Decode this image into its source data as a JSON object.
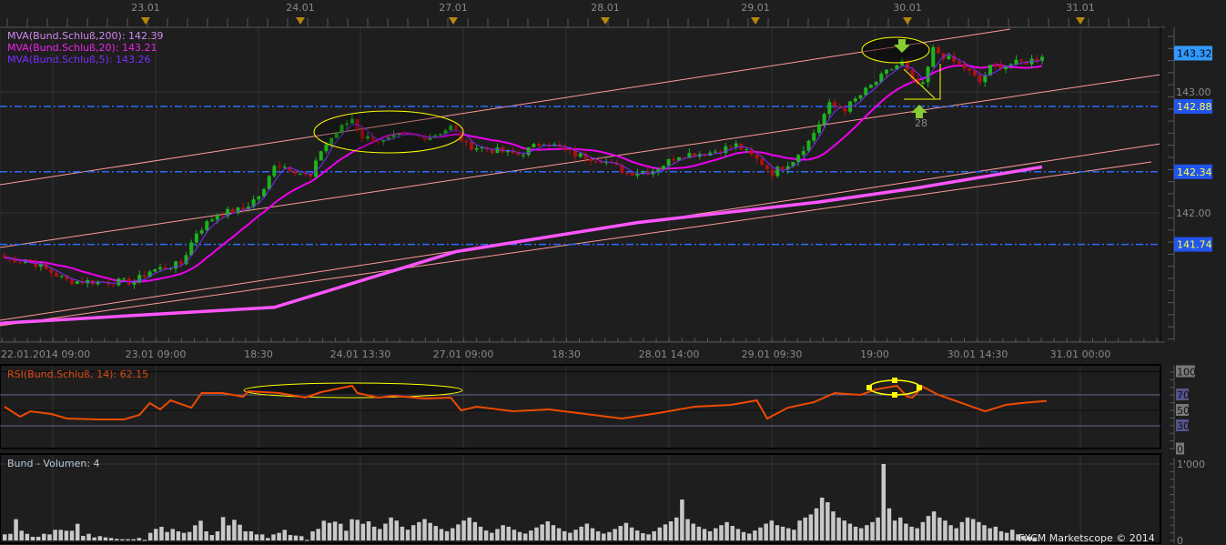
{
  "top_axis": {
    "dates": [
      "23.01",
      "24.01",
      "27.01",
      "28.01",
      "29.01",
      "30.01",
      "31.01"
    ]
  },
  "legend": {
    "ma200": "MVA(Bund.Schluß,200): 142.39",
    "ma20": "MVA(Bund.Schluß,20): 143.21",
    "ma5": "MVA(Bund.Schluß,5): 143.26"
  },
  "price_axis": {
    "ticks": [
      "143.00",
      "142.00"
    ],
    "current": "143.32",
    "levels": [
      "142.88",
      "142.34",
      "141.74"
    ]
  },
  "marker_label": "28",
  "time_axis": [
    "22.01.2014 09:00",
    "23.01 09:00",
    "18:30",
    "24.01 13:30",
    "27.01 09:00",
    "18:30",
    "28.01 14:00",
    "29.01 09:30",
    "19:00",
    "30.01 14:30",
    "31.01 00:00"
  ],
  "rsi": {
    "label": "RSI(Bund.Schluß, 14): 62.15",
    "ticks": [
      "100",
      "70",
      "50",
      "30",
      "0"
    ]
  },
  "volume": {
    "label": "Bund - Volumen: 4",
    "ticks": [
      "1'000",
      "0"
    ]
  },
  "watermark": "FXCM Marketscope © 2014",
  "colors": {
    "bg": "#1e1e1e",
    "up": "#1db31d",
    "down": "#b01010",
    "ma200": "#ff55ff",
    "ma20": "#ee00ee",
    "ma5": "#7a2cff",
    "rsi": "#ee4a00",
    "level": "#2a6bff",
    "channel": "#ff9a9a",
    "annotation": "#ffff00"
  },
  "chart_data": [
    {
      "type": "candlestick",
      "title": "Bund",
      "x_unit": "bar index",
      "close_keypoints": [
        [
          0,
          141.63
        ],
        [
          6,
          141.58
        ],
        [
          12,
          141.44
        ],
        [
          18,
          141.43
        ],
        [
          25,
          141.43
        ],
        [
          28,
          141.52
        ],
        [
          34,
          141.58
        ],
        [
          37,
          141.84
        ],
        [
          41,
          141.99
        ],
        [
          46,
          142.03
        ],
        [
          50,
          142.18
        ],
        [
          52,
          142.41
        ],
        [
          55,
          142.37
        ],
        [
          59,
          142.29
        ],
        [
          61,
          142.52
        ],
        [
          64,
          142.67
        ],
        [
          67,
          142.78
        ],
        [
          69,
          142.63
        ],
        [
          73,
          142.59
        ],
        [
          76,
          142.63
        ],
        [
          82,
          142.63
        ],
        [
          86,
          142.71
        ],
        [
          89,
          142.56
        ],
        [
          94,
          142.52
        ],
        [
          99,
          142.48
        ],
        [
          104,
          142.59
        ],
        [
          110,
          142.48
        ],
        [
          115,
          142.44
        ],
        [
          120,
          142.33
        ],
        [
          125,
          142.35
        ],
        [
          130,
          142.48
        ],
        [
          136,
          142.5
        ],
        [
          141,
          142.56
        ],
        [
          146,
          142.41
        ],
        [
          148,
          142.33
        ],
        [
          152,
          142.44
        ],
        [
          155,
          142.59
        ],
        [
          159,
          142.89
        ],
        [
          162,
          142.86
        ],
        [
          166,
          143.01
        ],
        [
          170,
          143.16
        ],
        [
          173,
          143.25
        ],
        [
          175,
          143.08
        ],
        [
          177,
          143.05
        ],
        [
          179,
          143.35
        ],
        [
          182,
          143.27
        ],
        [
          185,
          143.2
        ],
        [
          188,
          143.08
        ],
        [
          190,
          143.2
        ],
        [
          194,
          143.23
        ],
        [
          197,
          143.25
        ],
        [
          200,
          143.29
        ]
      ],
      "ma200_keypoints": [
        [
          0,
          141.09
        ],
        [
          52,
          141.22
        ],
        [
          87,
          141.68
        ],
        [
          122,
          141.92
        ],
        [
          157,
          142.09
        ],
        [
          175,
          142.2
        ],
        [
          200,
          142.38
        ]
      ],
      "horizontal_levels": [
        142.88,
        142.34,
        141.74
      ],
      "last_price": 143.32,
      "ylim": [
        141.0,
        143.55
      ]
    },
    {
      "type": "line",
      "title": "RSI(Bund.Schluß, 14)",
      "points": [
        [
          0,
          54.7
        ],
        [
          3,
          41.8
        ],
        [
          5,
          48.8
        ],
        [
          9,
          45.3
        ],
        [
          12,
          39.4
        ],
        [
          18,
          38.2
        ],
        [
          23,
          38.2
        ],
        [
          26,
          44.1
        ],
        [
          28,
          59.4
        ],
        [
          30,
          51.2
        ],
        [
          32,
          62.9
        ],
        [
          36,
          53.5
        ],
        [
          38,
          72.4
        ],
        [
          42,
          72.4
        ],
        [
          46,
          67.6
        ],
        [
          47,
          74.7
        ],
        [
          53,
          72.4
        ],
        [
          58,
          66.5
        ],
        [
          61,
          73.5
        ],
        [
          67,
          81.8
        ],
        [
          68,
          72.4
        ],
        [
          72,
          66.5
        ],
        [
          75,
          68.8
        ],
        [
          81,
          65.3
        ],
        [
          86,
          66.5
        ],
        [
          88,
          50
        ],
        [
          91,
          54.7
        ],
        [
          98,
          48.8
        ],
        [
          105,
          51.2
        ],
        [
          112,
          45.3
        ],
        [
          119,
          39.4
        ],
        [
          126,
          46.5
        ],
        [
          133,
          54.7
        ],
        [
          140,
          57.1
        ],
        [
          145,
          62.9
        ],
        [
          147,
          39.4
        ],
        [
          151,
          53.5
        ],
        [
          156,
          60.6
        ],
        [
          160,
          72.4
        ],
        [
          165,
          70
        ],
        [
          168,
          77
        ],
        [
          172,
          81.8
        ],
        [
          174,
          67.6
        ],
        [
          175,
          66.5
        ],
        [
          177,
          80.6
        ],
        [
          180,
          70
        ],
        [
          184,
          60.6
        ],
        [
          189,
          48.8
        ],
        [
          193,
          57.1
        ],
        [
          196,
          59.4
        ],
        [
          201,
          62.15
        ]
      ],
      "levels": [
        100,
        70,
        50,
        30,
        0
      ],
      "ylim": [
        0,
        100
      ]
    },
    {
      "type": "bar",
      "title": "Bund - Volumen",
      "values": [
        80,
        87,
        278,
        127,
        87,
        48,
        48,
        87,
        79,
        139,
        139,
        127,
        127,
        218,
        60,
        87,
        40,
        56,
        40,
        32,
        20,
        16,
        16,
        16,
        32,
        8,
        99,
        151,
        179,
        111,
        151,
        119,
        99,
        111,
        198,
        258,
        119,
        71,
        119,
        306,
        198,
        270,
        206,
        119,
        119,
        79,
        79,
        32,
        79,
        99,
        139,
        71,
        64,
        56,
        8,
        119,
        151,
        258,
        230,
        246,
        218,
        127,
        278,
        270,
        218,
        250,
        180,
        150,
        220,
        300,
        260,
        180,
        140,
        200,
        240,
        280,
        230,
        190,
        150,
        120,
        160,
        210,
        260,
        300,
        240,
        180,
        130,
        100,
        150,
        200,
        180,
        140,
        110,
        90,
        130,
        170,
        210,
        250,
        200,
        160,
        120,
        100,
        140,
        180,
        220,
        160,
        120,
        90,
        110,
        150,
        190,
        230,
        170,
        130,
        95,
        80,
        120,
        170,
        210,
        250,
        300,
        535,
        280,
        220,
        180,
        150,
        120,
        160,
        200,
        240,
        190,
        150,
        110,
        90,
        130,
        170,
        220,
        260,
        200,
        180,
        160,
        140,
        260,
        300,
        340,
        420,
        560,
        500,
        380,
        300,
        260,
        220,
        180,
        160,
        200,
        240,
        300,
        1000,
        420,
        260,
        300,
        220,
        180,
        160,
        240,
        320,
        380,
        300,
        260,
        200,
        160,
        240,
        300,
        280,
        240,
        200,
        160,
        180,
        120,
        100,
        140,
        80,
        60,
        50,
        40
      ],
      "ylim": [
        0,
        1000
      ]
    }
  ]
}
